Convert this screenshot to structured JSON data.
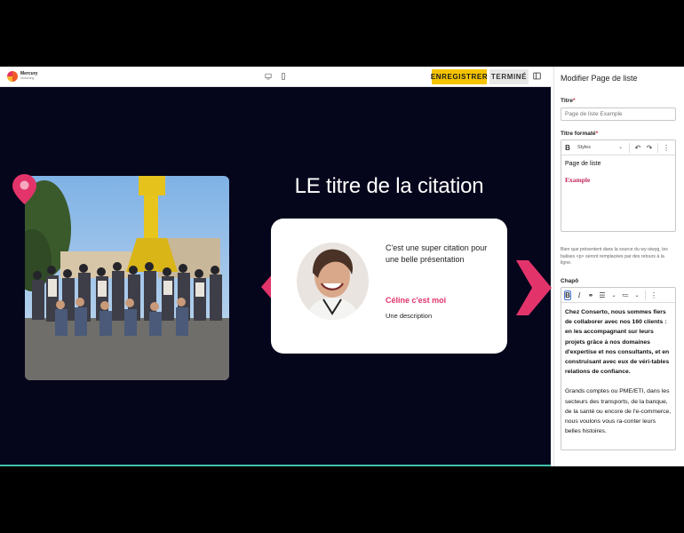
{
  "topbar": {
    "logo_name": "Mercury",
    "logo_sub": "Marketing",
    "desktop_icon": "desktop-icon",
    "mobile_icon": "mobile-icon",
    "save_label": "ENREGISTRER",
    "done_label": "TERMINÉ",
    "panel_icon": "panel-toggle-icon"
  },
  "canvas": {
    "quote_title": "LE titre de la citation",
    "quote_text": "C'est une super citation pour une belle présentation",
    "author": "Céline c'est moi",
    "description": "Une description",
    "accent_color": "#e2346b",
    "background_color": "#05051c"
  },
  "panel": {
    "title": "Modifier Page de liste",
    "titre_label": "Titre",
    "required_mark": "*",
    "titre_placeholder": "Page de liste Example",
    "titre_formate_label": "Titre formaté",
    "styles_label": "Styles",
    "formatted_line1": "Page de liste",
    "formatted_line2": "Example",
    "hint": "Bien que présentent dans la source du wy-siwyg, les balises <p> seront remplacées par des retours à la ligne.",
    "chapo_label": "Chapô",
    "chapo_bold": "Chez Conserto, nous sommes fiers de collaborer avec nos 160 clients :",
    "chapo_bold2": "en les accompagnant sur leurs projets grâce à nos domaines d'expertise et nos consultants, et en construisant avec eux de véri-tables relations de confiance.",
    "chapo_text": "Grands comptes ou PME/ETI, dans les secteurs des transports, de la banque, de la santé ou encore de l'e-commerce, nous voulons vous ra-conter leurs belles histoires."
  }
}
